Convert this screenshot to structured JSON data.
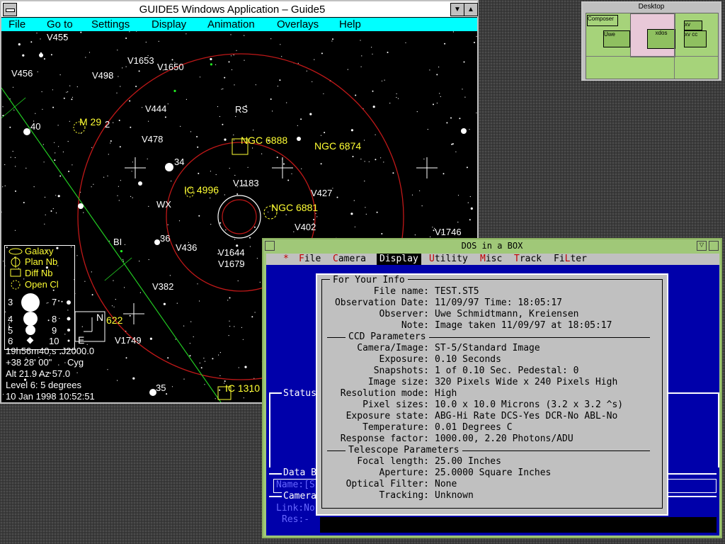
{
  "guide": {
    "title": "GUIDE5 Windows Application – Guide5",
    "min_glyph": "▼",
    "max_glyph": "▲",
    "menu": [
      "File",
      "Go to",
      "Settings",
      "Display",
      "Animation",
      "Overlays",
      "Help"
    ],
    "star_labels": [
      {
        "text": "V455"
      },
      {
        "text": "V1653"
      },
      {
        "text": "V1650"
      },
      {
        "text": "V456"
      },
      {
        "text": "V498"
      },
      {
        "text": "V444"
      },
      {
        "text": "RS"
      },
      {
        "text": "40"
      },
      {
        "text": "V478"
      },
      {
        "text": "34"
      },
      {
        "text": "V1183"
      },
      {
        "text": "V427"
      },
      {
        "text": "WX"
      },
      {
        "text": "V402"
      },
      {
        "text": "BI"
      },
      {
        "text": "36"
      },
      {
        "text": "V436"
      },
      {
        "text": "V1644"
      },
      {
        "text": "V1679"
      },
      {
        "text": "V382"
      },
      {
        "text": "V1749"
      },
      {
        "text": "35"
      },
      {
        "text": "V1746"
      },
      {
        "text": "2"
      }
    ],
    "object_labels": [
      {
        "text": "M 29"
      },
      {
        "text": "NGC 6888"
      },
      {
        "text": "NGC 6874"
      },
      {
        "text": "IC 4996"
      },
      {
        "text": "NGC 6881"
      },
      {
        "text": "IC 1310"
      },
      {
        "text": "622"
      }
    ],
    "legend": {
      "types": [
        "Galaxy",
        "Plan Nb",
        "Diff Nb",
        "Open Cl"
      ],
      "mags": [
        "3",
        "4",
        "5",
        "6",
        "7",
        "8",
        "9",
        "10"
      ]
    },
    "compass": {
      "north": "N",
      "east": "E"
    },
    "info": {
      "ra": "19h56m40.s",
      "epoch": "J2000.0",
      "dec": "+38 28' 00\"",
      "constellation": "Cyg",
      "altaz": "Alt 21.9  Az 57.0",
      "level": "Level 6: 5 degrees",
      "datetime": "10 Jan 1998 10:52:51"
    }
  },
  "pager": {
    "title": "Desktop",
    "windows": [
      "Composer",
      "Uwe",
      "xdos",
      "xv",
      "xv cc"
    ]
  },
  "dos": {
    "title": "DOS in a BOX",
    "menu_star": "*",
    "menu": [
      "File",
      "Camera",
      "Display",
      "Utility",
      "Misc",
      "Track",
      "FiLter"
    ],
    "menu_hot": [
      "F",
      "C",
      "D",
      "U",
      "M",
      "T",
      "L"
    ],
    "side": {
      "status": "Status",
      "data_b": "Data B",
      "name": "Name:[S",
      "camera": "Camera",
      "link": "Link:No",
      "res": "Res:-"
    },
    "info_box": {
      "title": "For Your Info",
      "fields1": [
        {
          "k": "File name:",
          "v": "TEST.ST5"
        },
        {
          "k": "Observation Date:",
          "v": "11/09/97  Time: 18:05:17"
        },
        {
          "k": "Observer:",
          "v": "Uwe Schmidtmann, Kreiensen"
        },
        {
          "k": "Note:",
          "v": "Image taken 11/09/97 at 18:05:17"
        }
      ],
      "section2": "CCD Parameters",
      "fields2": [
        {
          "k": "Camera/Image:",
          "v": "ST-5/Standard Image"
        },
        {
          "k": "Exposure:",
          "v": "0.10 Seconds"
        },
        {
          "k": "Snapshots:",
          "v": "1 of 0.10 Sec.  Pedestal: 0"
        },
        {
          "k": "Image size:",
          "v": "320 Pixels Wide x 240 Pixels High"
        },
        {
          "k": "Resolution mode:",
          "v": "High"
        },
        {
          "k": "Pixel sizes:",
          "v": "10.0 x 10.0 Microns (3.2 x 3.2 ^s)"
        },
        {
          "k": "Exposure state:",
          "v": "ABG-Hi Rate  DCS-Yes  DCR-No  ABL-No"
        },
        {
          "k": "Temperature:",
          "v": "0.01 Degrees C"
        },
        {
          "k": "Response factor:",
          "v": "1000.00, 2.20 Photons/ADU"
        }
      ],
      "section3": "Telescope Parameters",
      "fields3": [
        {
          "k": "Focal length:",
          "v": "25.00 Inches"
        },
        {
          "k": "Aperture:",
          "v": "25.0000 Square Inches"
        },
        {
          "k": "Optical Filter:",
          "v": "None"
        },
        {
          "k": "Tracking:",
          "v": "Unknown"
        }
      ]
    }
  }
}
